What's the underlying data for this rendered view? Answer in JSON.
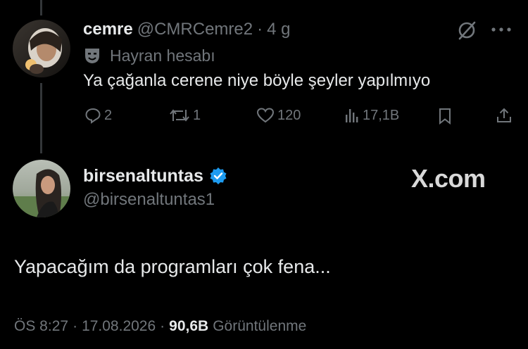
{
  "reply_tweet": {
    "display_name": "cemre",
    "handle": "@CMRCemre2",
    "separator": "·",
    "time_ago": "4 g",
    "fan_label": "Hayran hesabı",
    "text": "Ya çağanla cerene niye böyle şeyler yapılmıyo",
    "replies": "2",
    "reposts": "1",
    "likes": "120",
    "views": "17,1B"
  },
  "main_tweet": {
    "display_name": "birsenaltuntas",
    "handle": "@birsenaltuntas1",
    "watermark": "X.com",
    "text": "Yapacağım da programları çok fena...",
    "time": "ÖS 8:27",
    "dot1": "·",
    "date": "17.08.2026",
    "dot2": "·",
    "views_count": "90,6B",
    "views_label": "Görüntülenme"
  },
  "colors": {
    "background": "#000000",
    "text": "#e7e9ea",
    "secondary": "#71767b",
    "verified": "#1d9bf0"
  }
}
